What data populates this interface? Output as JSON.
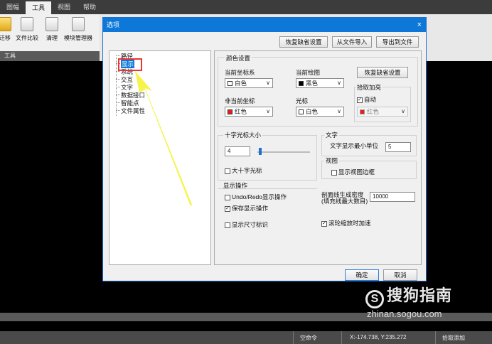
{
  "menubar": {
    "items": [
      "图幅",
      "工具",
      "视图",
      "帮助"
    ]
  },
  "ribbon": {
    "tools": [
      "迁移",
      "文件比较",
      "清理",
      "模块管理器"
    ],
    "panel_label": "工具"
  },
  "dialog": {
    "title": "选项",
    "close": "×",
    "top_buttons": {
      "restore": "恢复缺省设置",
      "import": "从文件导入",
      "export": "导出到文件"
    },
    "tree": [
      "路径",
      "显示",
      "系统",
      "交互",
      "文字",
      "数据接口",
      "智能点",
      "文件属性"
    ],
    "tree_selected": "显示",
    "colors": {
      "group_title": "颜色设置",
      "current_coord_label": "当前坐标系",
      "current_coord_value": "白色",
      "current_drawing_label": "当前绘图",
      "current_drawing_value": "黑色",
      "noncurrent_coord_label": "非当前坐标",
      "noncurrent_coord_value": "红色",
      "cursor_label": "光标",
      "cursor_value": "白色",
      "restore_label": "恢复缺省设置",
      "pick_group": "拾取加亮",
      "auto_label": "自动",
      "pick_value": "红色",
      "swatch_white": "#ffffff",
      "swatch_black": "#000000",
      "swatch_red": "#e02020"
    },
    "crosshair": {
      "title": "十字光标大小",
      "value": "4",
      "big_label": "大十字光标"
    },
    "text": {
      "title": "文字",
      "min_unit_label": "文字显示最小单位",
      "min_unit_value": "5"
    },
    "view": {
      "title": "视图",
      "border_label": "显示视图边框"
    },
    "display_ops": {
      "title": "显示操作",
      "undo_label": "Undo/Redo显示操作",
      "save_label": "保存显示操作",
      "size_label": "显示尺寸标识"
    },
    "hatch": {
      "label_line1": "剖面线生成密度",
      "label_line2": "(填充线最大数目)",
      "value": "10000"
    },
    "wheel_label": "滚轮缩放时加速",
    "ok": "确定",
    "cancel": "取消"
  },
  "status": {
    "command": "空命令",
    "coords": "X:-174.738, Y:235.272",
    "pick": "拾取添加"
  },
  "watermark": {
    "title": "搜狗指南",
    "logo": "S",
    "url": "zhinan.sogou.com"
  }
}
